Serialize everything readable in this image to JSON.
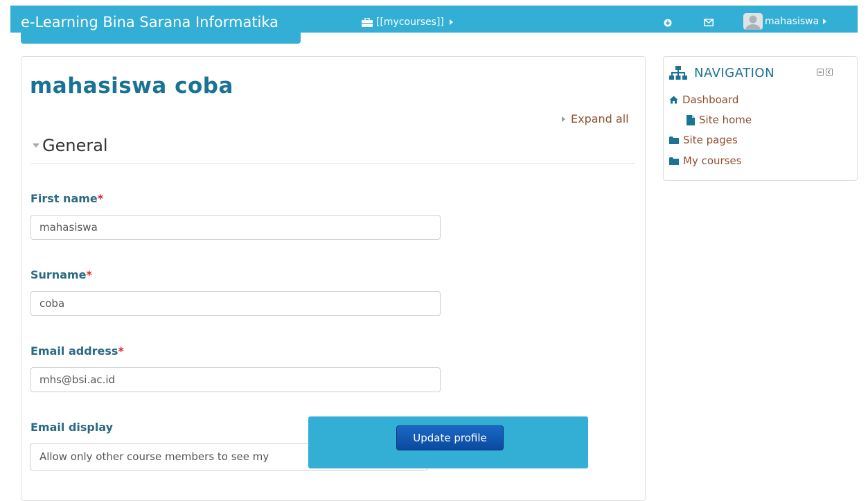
{
  "header": {
    "brand": "e-Learning Bina Sarana Informatika",
    "mycourses": "[[mycourses]]",
    "user_name": "mahasiswa"
  },
  "page": {
    "title": "mahasiswa coba",
    "expand_all": "Expand all",
    "section_general": "General"
  },
  "form": {
    "first_name": {
      "label": "First name",
      "required_mark": "*",
      "value": "mahasiswa"
    },
    "surname": {
      "label": "Surname",
      "required_mark": "*",
      "value": "coba"
    },
    "email": {
      "label": "Email address",
      "required_mark": "*",
      "value": "mhs@bsi.ac.id"
    },
    "email_display": {
      "label": "Email display",
      "selected": "Allow only other course members to see my"
    }
  },
  "popup": {
    "update_label": "Update profile"
  },
  "navigation": {
    "title": "NAVIGATION",
    "items": [
      {
        "label": "Dashboard",
        "icon": "home-icon"
      },
      {
        "label": "Site home",
        "icon": "page-icon"
      },
      {
        "label": "Site pages",
        "icon": "folder-icon"
      },
      {
        "label": "My courses",
        "icon": "folder-icon"
      }
    ]
  },
  "colors": {
    "topbar": "#33aed4",
    "title": "#1a7394",
    "link": "#8f4e2d",
    "button": "#0a4aa0"
  }
}
